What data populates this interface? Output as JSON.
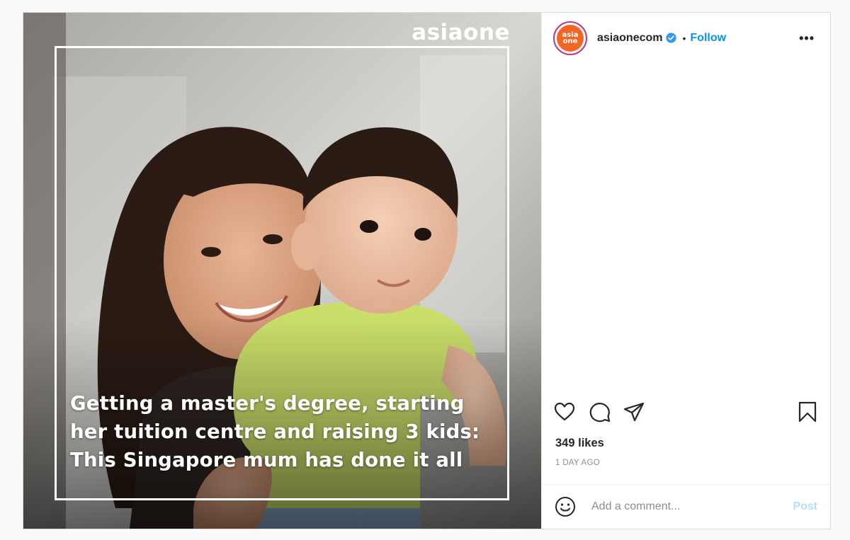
{
  "media": {
    "brand_logo": "asiaone",
    "headline": "Getting a master's degree, starting her tuition centre and raising 3 kids: This Singapore mum has done it all"
  },
  "header": {
    "avatar_text_top": "asia",
    "avatar_text_bottom": "one",
    "username": "asiaonecom",
    "verified_icon": "verified-badge-icon",
    "separator": "•",
    "follow_label": "Follow",
    "more_icon": "more-options-icon",
    "more_label": "•••"
  },
  "actions": {
    "like_icon": "heart-icon",
    "comment_icon": "comment-icon",
    "share_icon": "send-icon",
    "save_icon": "bookmark-icon"
  },
  "stats": {
    "likes": "349 likes",
    "time": "1 DAY AGO"
  },
  "comment": {
    "emoji_icon": "smiley-icon",
    "placeholder": "Add a comment...",
    "post_label": "Post"
  },
  "colors": {
    "accent": "#0095f6",
    "post_disabled": "#b2dffc",
    "brand_orange": "#f26522"
  }
}
